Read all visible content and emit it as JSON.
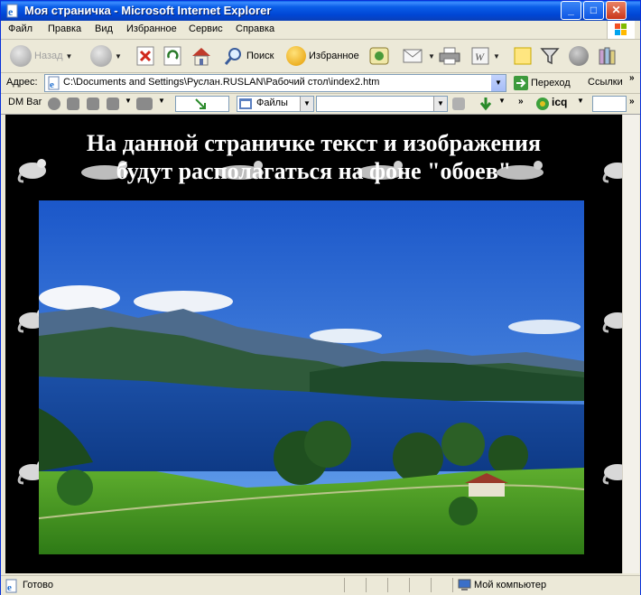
{
  "window": {
    "title": "Моя страничка - Microsoft Internet Explorer"
  },
  "menu": [
    "Файл",
    "Правка",
    "Вид",
    "Избранное",
    "Сервис",
    "Справка"
  ],
  "toolbar": {
    "back_label": "Назад",
    "search_label": "Поиск",
    "favorites_label": "Избранное"
  },
  "address": {
    "label": "Адрес:",
    "url": "C:\\Documents and Settings\\Руслан.RUSLAN\\Рабочий стол\\index2.htm",
    "go_label": "Переход",
    "links_label": "Ссылки"
  },
  "dmbar": {
    "label": "DM Bar",
    "files_label": "Файлы",
    "icq_label": "icq"
  },
  "page": {
    "heading_line1": "На данной страничке текст и изображения",
    "heading_line2": "будут располагаться на фоне \"обоев\""
  },
  "status": {
    "text": "Готово",
    "zone": "Мой компьютер"
  },
  "colors": {
    "titlebar": "#0a5ee8",
    "chrome": "#ece9d8",
    "page_background": "#000000",
    "heading_text": "#ffffff"
  }
}
